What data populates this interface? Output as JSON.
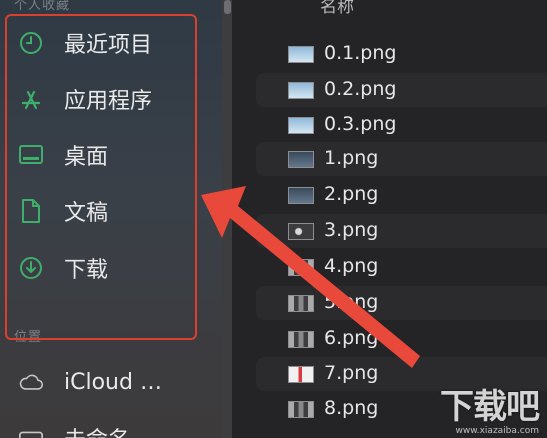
{
  "sidebar": {
    "favorites_header": "个人收藏",
    "items": [
      {
        "label": "最近项目",
        "icon": "clock-icon"
      },
      {
        "label": "应用程序",
        "icon": "apps-icon"
      },
      {
        "label": "桌面",
        "icon": "desktop-icon"
      },
      {
        "label": "文稿",
        "icon": "document-icon"
      },
      {
        "label": "下载",
        "icon": "download-icon"
      }
    ],
    "locations_header": "位置",
    "locations": [
      {
        "label": "iCloud …",
        "icon": "cloud-icon"
      },
      {
        "label": "未命名",
        "icon": "disk-icon"
      }
    ],
    "accent_color": "#3fae6a"
  },
  "file_list": {
    "column_name": "名称",
    "files": [
      {
        "name": "0.1.png"
      },
      {
        "name": "0.2.png"
      },
      {
        "name": "0.3.png"
      },
      {
        "name": "1.png"
      },
      {
        "name": "2.png"
      },
      {
        "name": "3.png"
      },
      {
        "name": "4.png"
      },
      {
        "name": "5.png"
      },
      {
        "name": "6.png"
      },
      {
        "name": "7.png"
      },
      {
        "name": "8.png"
      }
    ]
  },
  "annotation": {
    "color": "#e8493a"
  },
  "watermark": {
    "main": "下载吧",
    "sub": "www.xiazaiba.com"
  }
}
